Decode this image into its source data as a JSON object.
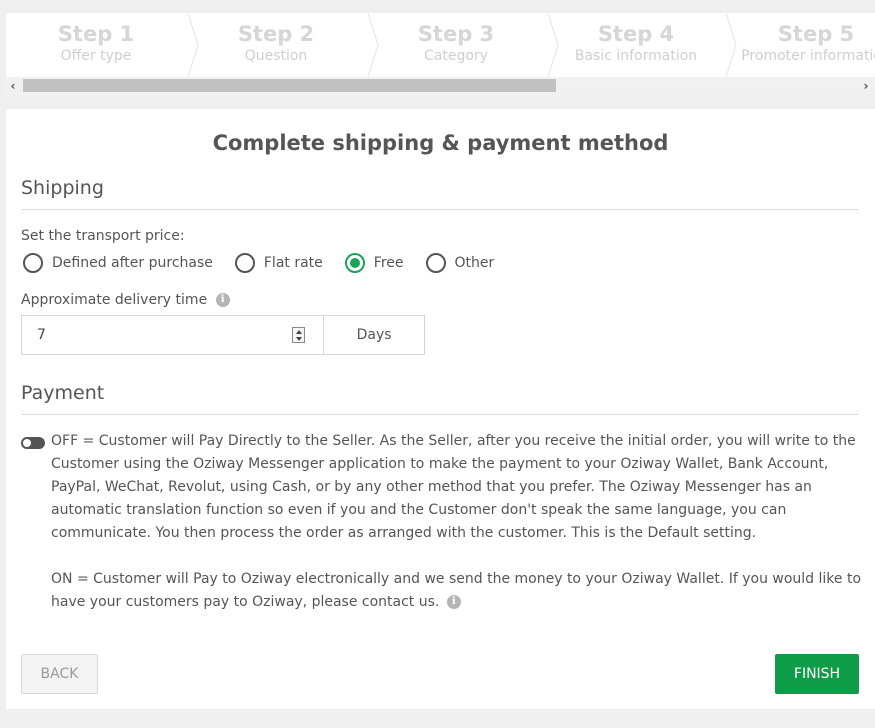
{
  "stepper": {
    "steps": [
      {
        "num": "Step 1",
        "label": "Offer type"
      },
      {
        "num": "Step 2",
        "label": "Question"
      },
      {
        "num": "Step 3",
        "label": "Category"
      },
      {
        "num": "Step 4",
        "label": "Basic information"
      },
      {
        "num": "Step 5",
        "label": "Promoter information"
      }
    ],
    "scroll_left_icon": "‹",
    "scroll_right_icon": "›"
  },
  "page": {
    "title": "Complete shipping & payment method"
  },
  "shipping": {
    "title": "Shipping",
    "transport_label": "Set the transport price:",
    "options": [
      {
        "label": "Defined after purchase",
        "checked": false
      },
      {
        "label": "Flat rate",
        "checked": false
      },
      {
        "label": "Free",
        "checked": true
      },
      {
        "label": "Other",
        "checked": false
      }
    ],
    "delivery_label": "Approximate delivery time",
    "delivery_value": "7",
    "delivery_unit": "Days"
  },
  "payment": {
    "title": "Payment",
    "toggle_on": false,
    "off_text": "OFF = Customer will Pay Directly to the Seller. As the Seller, after you receive the initial order, you will write to the Customer using the Oziway Messenger application to make the payment to your Oziway Wallet, Bank Account, PayPal, WeChat, Revolut, using Cash, or by any other method that you prefer. The Oziway Messenger has an automatic translation function so even if you and the Customer don't speak the same language, you can communicate. You then process the order as arranged with the customer. This is the Default setting.",
    "on_text": "ON = Customer will Pay to Oziway electronically and we send the money to your Oziway Wallet. If you would like to have your customers pay to Oziway, please contact us."
  },
  "buttons": {
    "back": "BACK",
    "finish": "FINISH"
  },
  "colors": {
    "accent": "#0f9c48",
    "radio_checked": "#19a35a"
  },
  "icons": {
    "info": "i"
  }
}
